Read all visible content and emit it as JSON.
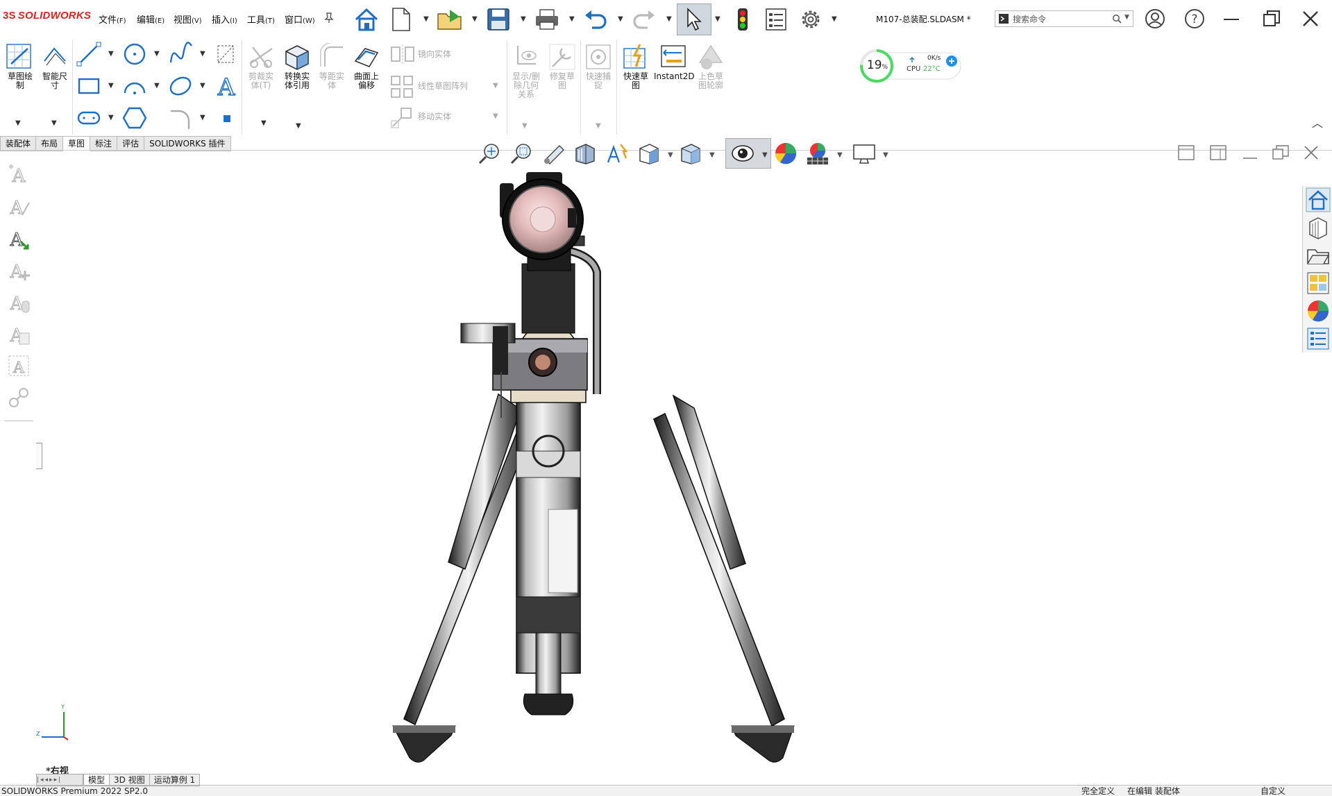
{
  "app": {
    "logo_text": "SOLIDWORKS",
    "document_title": "M107-总装配.SLDASM *"
  },
  "menu": [
    {
      "label": "文件",
      "key": "(F)"
    },
    {
      "label": "编辑",
      "key": "(E)"
    },
    {
      "label": "视图",
      "key": "(V)"
    },
    {
      "label": "插入",
      "key": "(I)"
    },
    {
      "label": "工具",
      "key": "(T)"
    },
    {
      "label": "窗口",
      "key": "(W)"
    }
  ],
  "search": {
    "placeholder": "搜索命令"
  },
  "ribbon": {
    "sketch_draw": "草图绘\n制",
    "smart_dim": "智能尺\n寸",
    "trim": "剪裁实\n体(T)",
    "convert": "转换实\n体引用",
    "offset_entity": "等距实\n体",
    "offset_surface": "曲面上\n偏移",
    "mirror": "镜向实体",
    "linear_pattern": "线性草图阵列",
    "move": "移动实体",
    "show_delete": "显示/删\n除几何\n关系",
    "repair": "修复草\n图",
    "quick_snap": "快速捕\n捉",
    "rapid_sketch": "快速草\n图",
    "instant2d": "Instant2D",
    "shaded_contour": "上色草\n图轮廓"
  },
  "tabs": [
    "装配体",
    "布局",
    "草图",
    "标注",
    "评估",
    "SOLIDWORKS 插件"
  ],
  "active_tab": "草图",
  "cpu_widget": {
    "percent": "19",
    "percent_unit": "%",
    "net_speed": "0K/s",
    "cpu_label": "CPU",
    "temp": "22°C",
    "value": 19
  },
  "viewport": {
    "view_name": "*右视",
    "triad_y": "Y",
    "triad_z": "Z"
  },
  "bottom_tabs": [
    "模型",
    "3D 视图",
    "运动算例 1"
  ],
  "status": {
    "left": "SOLIDWORKS Premium 2022 SP2.0",
    "right1": "完全定义",
    "right2": "在编辑 装配体",
    "right3": "自定义"
  },
  "colors": {
    "brand_red": "#d22020",
    "accent_blue": "#1e6fc4",
    "cpu_green": "#4cd964"
  }
}
